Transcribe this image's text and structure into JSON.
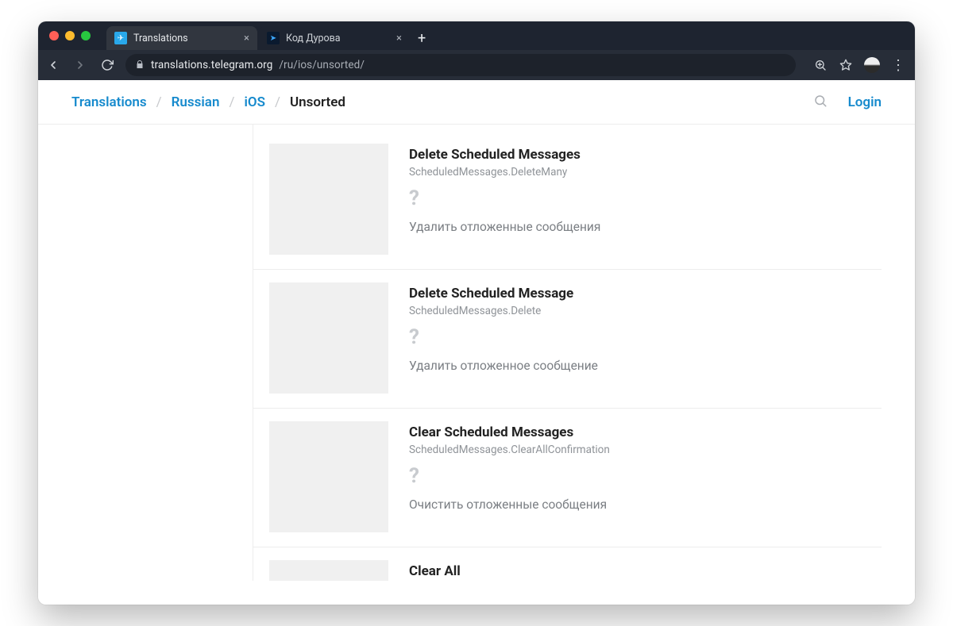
{
  "browser": {
    "tabs": [
      {
        "title": "Translations",
        "favicon_bg": "#29a8ea",
        "favicon_glyph": "✈"
      },
      {
        "title": "Код Дурова",
        "favicon_bg": "#0a1a2f",
        "favicon_glyph": "➤"
      }
    ],
    "url_host": "translations.telegram.org",
    "url_path": "/ru/ios/unsorted/"
  },
  "header": {
    "breadcrumb": [
      {
        "label": "Translations",
        "link": true
      },
      {
        "label": "Russian",
        "link": true
      },
      {
        "label": "iOS",
        "link": true
      },
      {
        "label": "Unsorted",
        "link": false
      }
    ],
    "login": "Login"
  },
  "entries": [
    {
      "title": "Delete Scheduled Messages",
      "key": "ScheduledMessages.DeleteMany",
      "qmark": "?",
      "translation": "Удалить отложенные сообщения"
    },
    {
      "title": "Delete Scheduled Message",
      "key": "ScheduledMessages.Delete",
      "qmark": "?",
      "translation": "Удалить отложенное сообщение"
    },
    {
      "title": "Clear Scheduled Messages",
      "key": "ScheduledMessages.ClearAllConfirmation",
      "qmark": "?",
      "translation": "Очистить отложенные сообщения"
    },
    {
      "title": "Clear All",
      "key": "",
      "qmark": "",
      "translation": ""
    }
  ]
}
